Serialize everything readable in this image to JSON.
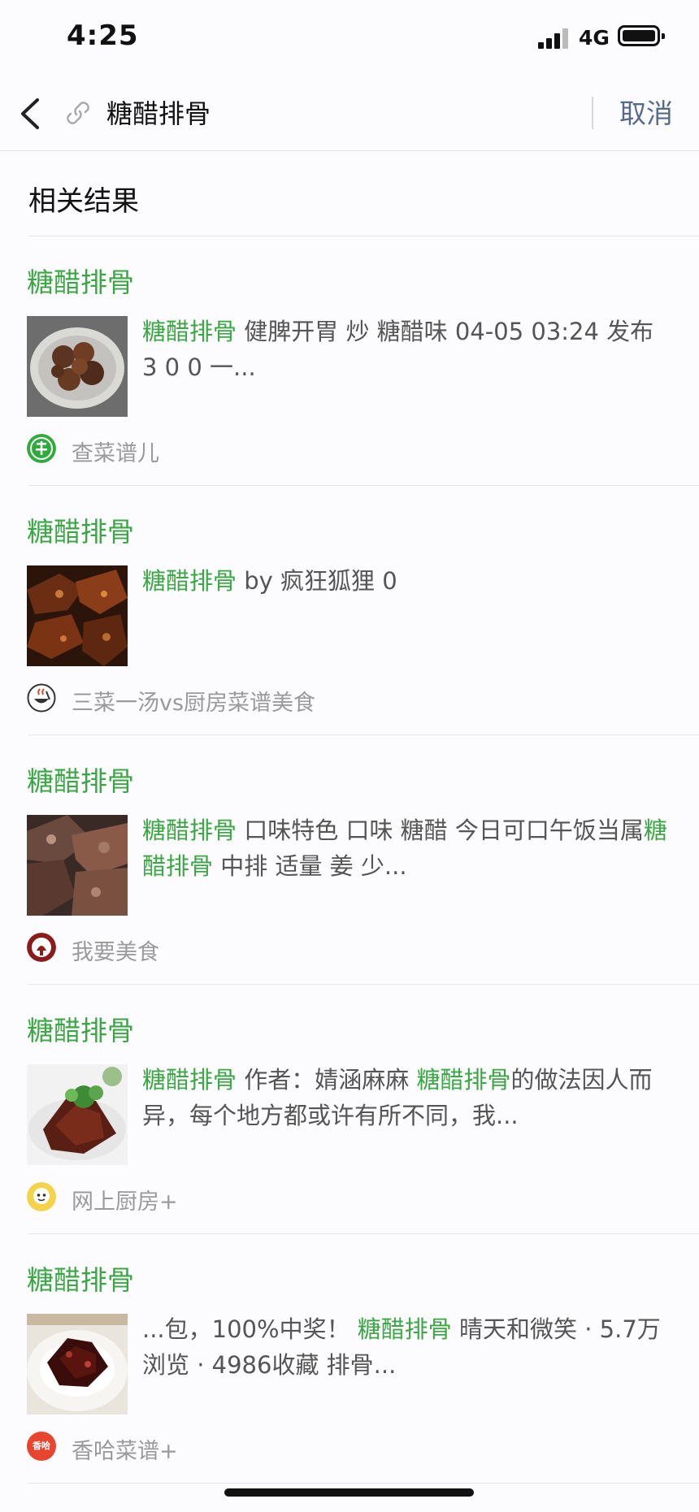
{
  "status_bar": {
    "time": "4:25",
    "network": "4G"
  },
  "search": {
    "query": "糖醋排骨",
    "cancel_label": "取消"
  },
  "section_title": "相关结果",
  "colors": {
    "highlight": "#3aa744",
    "cancel": "#566b8c"
  },
  "results": [
    {
      "title": "糖醋排骨",
      "desc": [
        {
          "text": "糖醋排骨",
          "hl": true
        },
        {
          "text": " 健脾开胃 炒 糖醋味 04-05 03:24 发布 3 0 0 一...",
          "hl": false
        }
      ],
      "source": "查菜谱儿",
      "source_icon": "cai-icon"
    },
    {
      "title": "糖醋排骨",
      "desc": [
        {
          "text": "糖醋排骨",
          "hl": true
        },
        {
          "text": " by 疯狂狐狸 0",
          "hl": false
        }
      ],
      "source": "三菜一汤vs厨房菜谱美食",
      "source_icon": "bowl-icon"
    },
    {
      "title": "糖醋排骨",
      "desc": [
        {
          "text": "糖醋排骨",
          "hl": true
        },
        {
          "text": " 口味特色 口味 糖醋 今日可口午饭当属",
          "hl": false
        },
        {
          "text": "糖醋排骨",
          "hl": true
        },
        {
          "text": " 中排 适量 姜 少...",
          "hl": false
        }
      ],
      "source": "我要美食",
      "source_icon": "chef-icon"
    },
    {
      "title": "糖醋排骨",
      "desc": [
        {
          "text": "糖醋排骨",
          "hl": true
        },
        {
          "text": " 作者：婧涵麻麻 ",
          "hl": false
        },
        {
          "text": "糖醋排骨",
          "hl": true
        },
        {
          "text": "的做法因人而异，每个地方都或许有所不同，我...",
          "hl": false
        }
      ],
      "source": "网上厨房+",
      "source_icon": "chef-hat-icon"
    },
    {
      "title": "糖醋排骨",
      "desc": [
        {
          "text": "...包，100%中奖！ ",
          "hl": false
        },
        {
          "text": "糖醋排骨",
          "hl": true
        },
        {
          "text": " 晴天和微笑 · 5.7万浏览 · 4986收藏 排骨...",
          "hl": false
        }
      ],
      "source": "香哈菜谱+",
      "source_icon": "xiangha-icon",
      "source_icon_text": "香哈"
    }
  ]
}
